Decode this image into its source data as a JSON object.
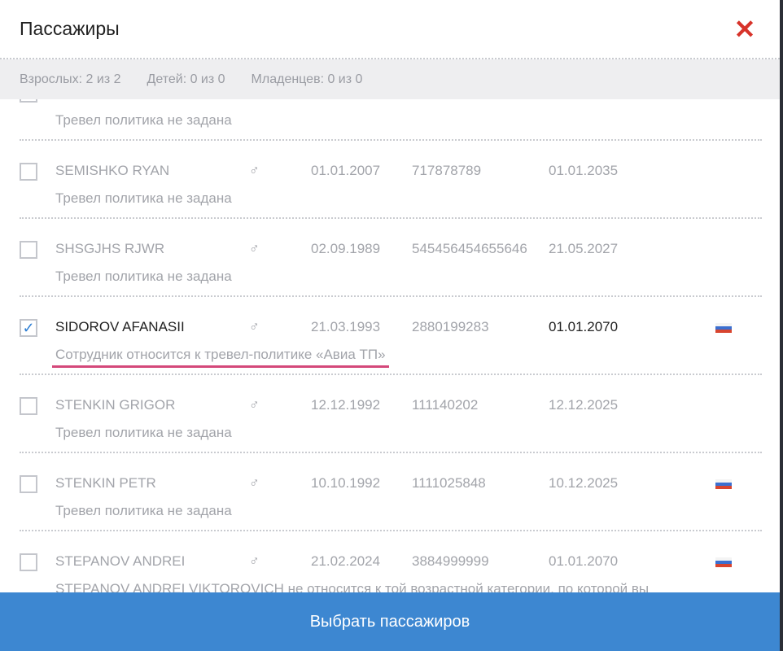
{
  "title": "Пассажиры",
  "counts": {
    "adults": "Взрослых: 2 из 2",
    "children": "Детей: 0 из 0",
    "infants": "Младенцев: 0 из 0"
  },
  "passengers": [
    {
      "name": "",
      "gender": "",
      "dob": "",
      "doc": "",
      "exp": "",
      "checked": false,
      "flag": false,
      "note": "Тревел политика не задана"
    },
    {
      "name": "SEMISHKO RYAN",
      "gender": "♂",
      "dob": "01.01.2007",
      "doc": "717878789",
      "exp": "01.01.2035",
      "checked": false,
      "flag": false,
      "note": "Тревел политика не задана"
    },
    {
      "name": "SHSGJHS RJWR",
      "gender": "♂",
      "dob": "02.09.1989",
      "doc": "545456454655646",
      "exp": "21.05.2027",
      "checked": false,
      "flag": false,
      "note": "Тревел политика не задана"
    },
    {
      "name": "SIDOROV AFANASII",
      "gender": "♂",
      "dob": "21.03.1993",
      "doc": "2880199283",
      "exp": "01.01.2070",
      "checked": true,
      "flag": true,
      "note": "Сотрудник относится к тревел-политике «Авиа ТП»"
    },
    {
      "name": "STENKIN GRIGOR",
      "gender": "♂",
      "dob": "12.12.1992",
      "doc": "111140202",
      "exp": "12.12.2025",
      "checked": false,
      "flag": false,
      "note": "Тревел политика не задана"
    },
    {
      "name": "STENKIN PETR",
      "gender": "♂",
      "dob": "10.10.1992",
      "doc": "1111025848",
      "exp": "10.12.2025",
      "checked": false,
      "flag": true,
      "note": "Тревел политика не задана"
    },
    {
      "name": "STEPANOV ANDREI",
      "gender": "♂",
      "dob": "21.02.2024",
      "doc": "3884999999",
      "exp": "01.01.2070",
      "checked": false,
      "flag": true,
      "note": "STEPANOV ANDREI VIKTOROVICH не относится к той возрастной категории, по которой вы"
    }
  ],
  "footer": {
    "button": "Выбрать пассажиров"
  },
  "colors": {
    "accent": "#3d87d1",
    "close": "#d7332a",
    "highlight": "#d4487a"
  }
}
